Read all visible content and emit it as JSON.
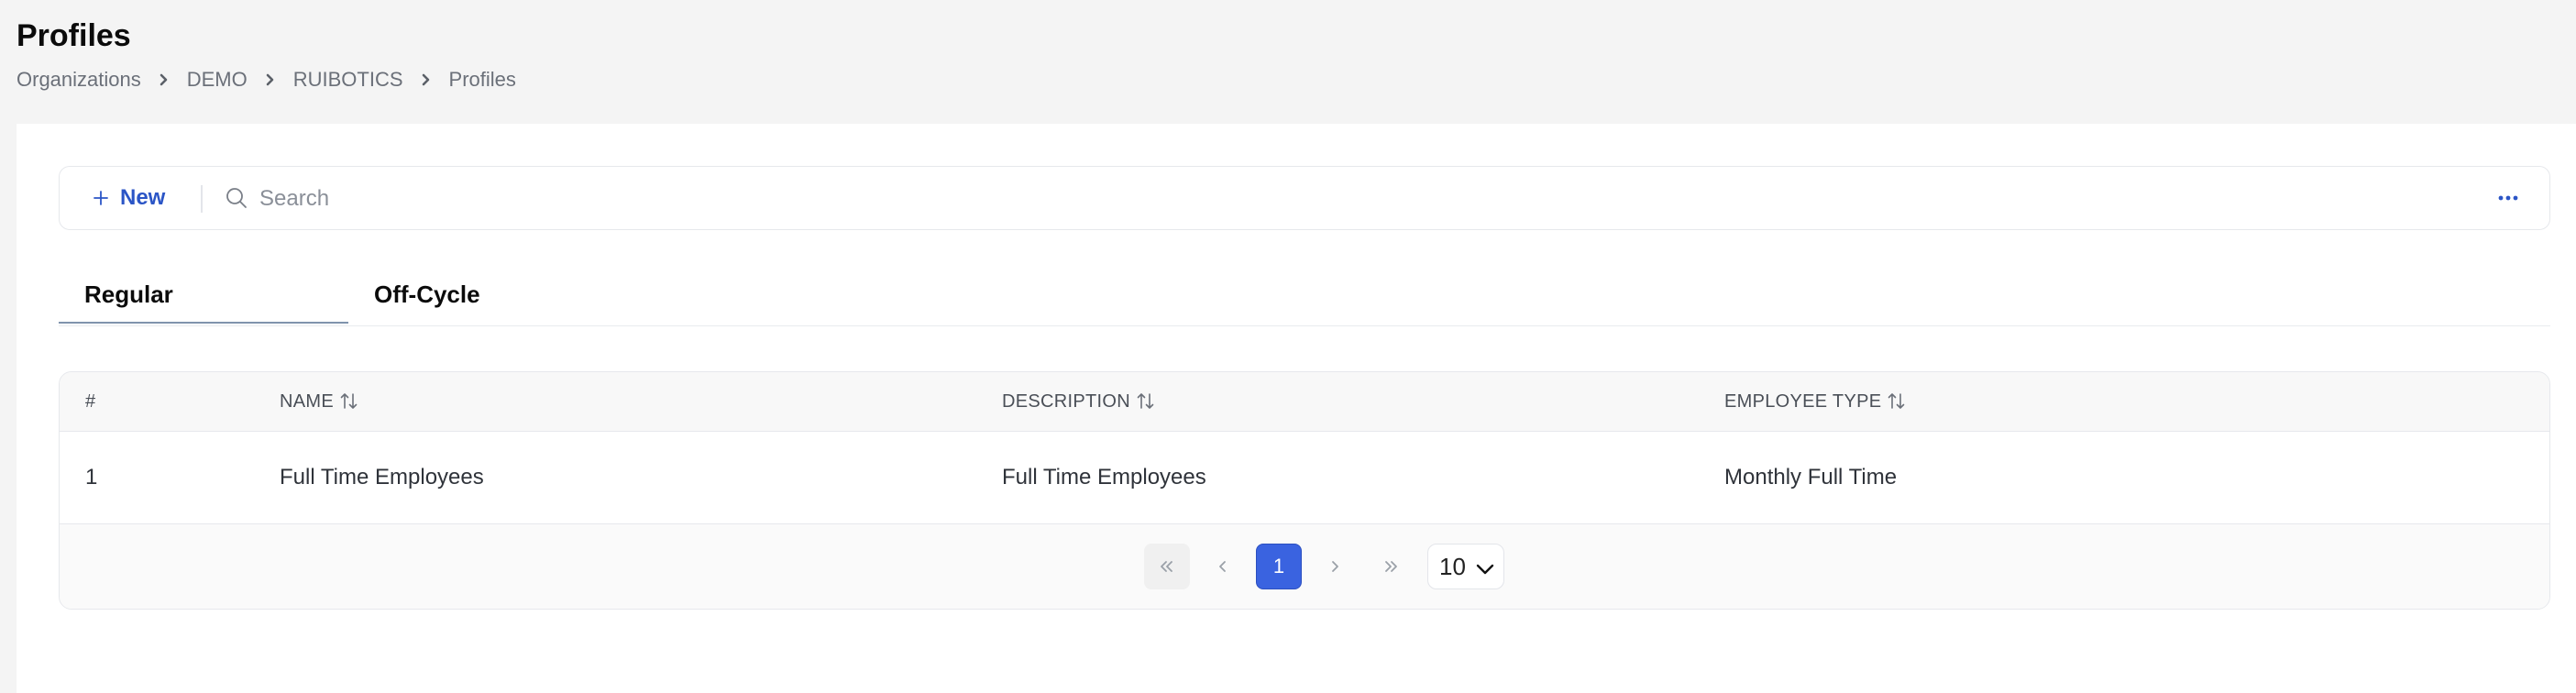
{
  "header": {
    "title": "Profiles",
    "breadcrumb": [
      "Organizations",
      "DEMO",
      "RUIBOTICS",
      "Profiles"
    ]
  },
  "toolbar": {
    "new_label": "New",
    "search_placeholder": "Search",
    "more_icon": "more-horizontal-icon"
  },
  "tabs": [
    {
      "label": "Regular",
      "active": true
    },
    {
      "label": "Off-Cycle",
      "active": false
    }
  ],
  "table": {
    "columns": [
      "#",
      "NAME",
      "DESCRIPTION",
      "EMPLOYEE TYPE"
    ],
    "rows": [
      {
        "num": "1",
        "name": "Full Time Employees",
        "description": "Full Time Employees",
        "employee_type": "Monthly Full Time"
      }
    ]
  },
  "pagination": {
    "current_page": "1",
    "page_size": "10"
  },
  "colors": {
    "accent": "#3a63e0",
    "link": "#2b55c6",
    "background": "#f4f4f4"
  }
}
